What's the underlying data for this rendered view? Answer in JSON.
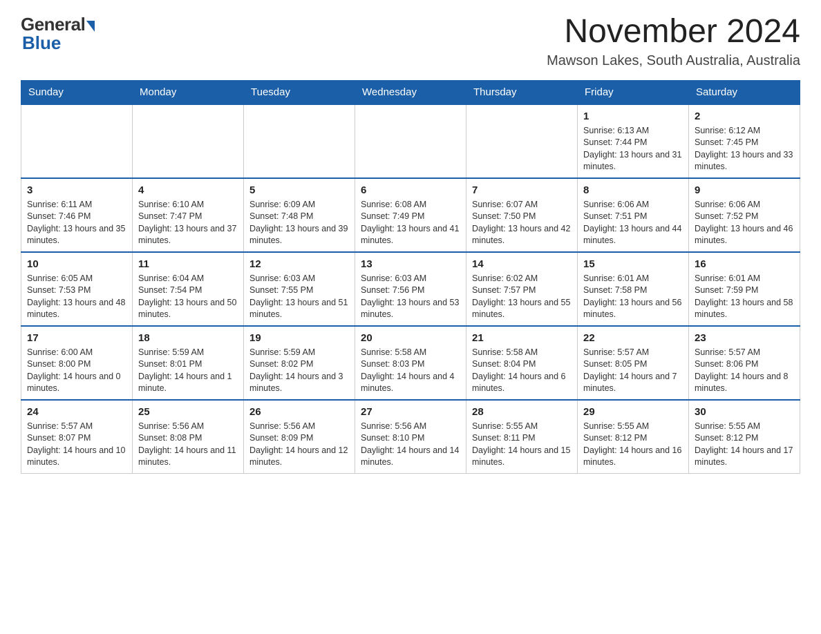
{
  "header": {
    "logo": {
      "general": "General",
      "blue": "Blue"
    },
    "title": "November 2024",
    "location": "Mawson Lakes, South Australia, Australia"
  },
  "days_of_week": [
    "Sunday",
    "Monday",
    "Tuesday",
    "Wednesday",
    "Thursday",
    "Friday",
    "Saturday"
  ],
  "weeks": [
    [
      {
        "day": "",
        "info": ""
      },
      {
        "day": "",
        "info": ""
      },
      {
        "day": "",
        "info": ""
      },
      {
        "day": "",
        "info": ""
      },
      {
        "day": "",
        "info": ""
      },
      {
        "day": "1",
        "info": "Sunrise: 6:13 AM\nSunset: 7:44 PM\nDaylight: 13 hours and 31 minutes."
      },
      {
        "day": "2",
        "info": "Sunrise: 6:12 AM\nSunset: 7:45 PM\nDaylight: 13 hours and 33 minutes."
      }
    ],
    [
      {
        "day": "3",
        "info": "Sunrise: 6:11 AM\nSunset: 7:46 PM\nDaylight: 13 hours and 35 minutes."
      },
      {
        "day": "4",
        "info": "Sunrise: 6:10 AM\nSunset: 7:47 PM\nDaylight: 13 hours and 37 minutes."
      },
      {
        "day": "5",
        "info": "Sunrise: 6:09 AM\nSunset: 7:48 PM\nDaylight: 13 hours and 39 minutes."
      },
      {
        "day": "6",
        "info": "Sunrise: 6:08 AM\nSunset: 7:49 PM\nDaylight: 13 hours and 41 minutes."
      },
      {
        "day": "7",
        "info": "Sunrise: 6:07 AM\nSunset: 7:50 PM\nDaylight: 13 hours and 42 minutes."
      },
      {
        "day": "8",
        "info": "Sunrise: 6:06 AM\nSunset: 7:51 PM\nDaylight: 13 hours and 44 minutes."
      },
      {
        "day": "9",
        "info": "Sunrise: 6:06 AM\nSunset: 7:52 PM\nDaylight: 13 hours and 46 minutes."
      }
    ],
    [
      {
        "day": "10",
        "info": "Sunrise: 6:05 AM\nSunset: 7:53 PM\nDaylight: 13 hours and 48 minutes."
      },
      {
        "day": "11",
        "info": "Sunrise: 6:04 AM\nSunset: 7:54 PM\nDaylight: 13 hours and 50 minutes."
      },
      {
        "day": "12",
        "info": "Sunrise: 6:03 AM\nSunset: 7:55 PM\nDaylight: 13 hours and 51 minutes."
      },
      {
        "day": "13",
        "info": "Sunrise: 6:03 AM\nSunset: 7:56 PM\nDaylight: 13 hours and 53 minutes."
      },
      {
        "day": "14",
        "info": "Sunrise: 6:02 AM\nSunset: 7:57 PM\nDaylight: 13 hours and 55 minutes."
      },
      {
        "day": "15",
        "info": "Sunrise: 6:01 AM\nSunset: 7:58 PM\nDaylight: 13 hours and 56 minutes."
      },
      {
        "day": "16",
        "info": "Sunrise: 6:01 AM\nSunset: 7:59 PM\nDaylight: 13 hours and 58 minutes."
      }
    ],
    [
      {
        "day": "17",
        "info": "Sunrise: 6:00 AM\nSunset: 8:00 PM\nDaylight: 14 hours and 0 minutes."
      },
      {
        "day": "18",
        "info": "Sunrise: 5:59 AM\nSunset: 8:01 PM\nDaylight: 14 hours and 1 minute."
      },
      {
        "day": "19",
        "info": "Sunrise: 5:59 AM\nSunset: 8:02 PM\nDaylight: 14 hours and 3 minutes."
      },
      {
        "day": "20",
        "info": "Sunrise: 5:58 AM\nSunset: 8:03 PM\nDaylight: 14 hours and 4 minutes."
      },
      {
        "day": "21",
        "info": "Sunrise: 5:58 AM\nSunset: 8:04 PM\nDaylight: 14 hours and 6 minutes."
      },
      {
        "day": "22",
        "info": "Sunrise: 5:57 AM\nSunset: 8:05 PM\nDaylight: 14 hours and 7 minutes."
      },
      {
        "day": "23",
        "info": "Sunrise: 5:57 AM\nSunset: 8:06 PM\nDaylight: 14 hours and 8 minutes."
      }
    ],
    [
      {
        "day": "24",
        "info": "Sunrise: 5:57 AM\nSunset: 8:07 PM\nDaylight: 14 hours and 10 minutes."
      },
      {
        "day": "25",
        "info": "Sunrise: 5:56 AM\nSunset: 8:08 PM\nDaylight: 14 hours and 11 minutes."
      },
      {
        "day": "26",
        "info": "Sunrise: 5:56 AM\nSunset: 8:09 PM\nDaylight: 14 hours and 12 minutes."
      },
      {
        "day": "27",
        "info": "Sunrise: 5:56 AM\nSunset: 8:10 PM\nDaylight: 14 hours and 14 minutes."
      },
      {
        "day": "28",
        "info": "Sunrise: 5:55 AM\nSunset: 8:11 PM\nDaylight: 14 hours and 15 minutes."
      },
      {
        "day": "29",
        "info": "Sunrise: 5:55 AM\nSunset: 8:12 PM\nDaylight: 14 hours and 16 minutes."
      },
      {
        "day": "30",
        "info": "Sunrise: 5:55 AM\nSunset: 8:12 PM\nDaylight: 14 hours and 17 minutes."
      }
    ]
  ]
}
